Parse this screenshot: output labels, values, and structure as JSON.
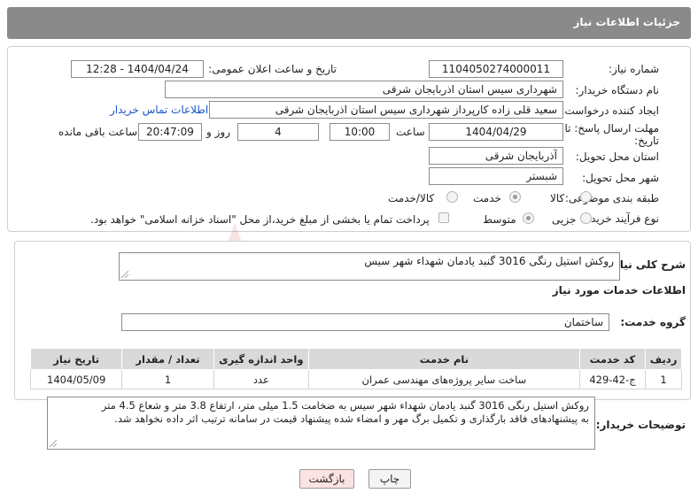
{
  "header": {
    "title": "جزئیات اطلاعات نیاز"
  },
  "form": {
    "need_number_label": "شماره نیاز:",
    "need_number": "1104050274000011",
    "announce_label": "تاریخ و ساعت اعلان عمومی:",
    "announce_value": "1404/04/24 - 12:28",
    "buyer_org_label": "نام دستگاه خریدار:",
    "buyer_org": "شهرداری سیس استان اذربایجان شرقی",
    "creator_label": "ایجاد کننده درخواست:",
    "creator": "سعید قلی زاده کارپرداز شهرداری سیس استان اذربایجان شرقی",
    "contact_link": "اطلاعات تماس خریدار",
    "deadline_label_1": "مهلت ارسال پاسخ: تا",
    "deadline_label_2": "تاریخ:",
    "deadline_date": "1404/04/29",
    "time_label": "ساعت",
    "deadline_time": "10:00",
    "days_value": "4",
    "days_label": "روز و",
    "remaining_time": "20:47:09",
    "remaining_label": "ساعت باقی مانده",
    "province_label": "استان محل تحویل:",
    "province": "آذربایجان شرقی",
    "city_label": "شهر محل تحویل:",
    "city": "شبستر",
    "category_label": "طبقه بندی موضوعی:",
    "category_options": [
      "کالا",
      "خدمت",
      "کالا/خدمت"
    ],
    "category_selected": "خدمت",
    "process_label": "نوع فرآیند خرید :",
    "process_options": [
      "جزیی",
      "متوسط"
    ],
    "process_selected": "متوسط",
    "payment_text": "پرداخت تمام یا بخشی از مبلغ خرید،از محل \"اسناد خزانه اسلامی\" خواهد بود."
  },
  "summary": {
    "label": "شرح کلی نیاز:",
    "text": "روکش استیل رنگی 3016 گنبد یادمان شهداء شهر سیس"
  },
  "services": {
    "section_title": "اطلاعات خدمات مورد نیاز",
    "group_label": "گروه خدمت:",
    "group_value": "ساختمان",
    "columns": [
      "ردیف",
      "کد خدمت",
      "نام خدمت",
      "واحد اندازه گیری",
      "تعداد / مقدار",
      "تاریخ نیاز"
    ],
    "rows": [
      [
        "1",
        "ج-42-429",
        "ساخت سایر پروژه‌های مهندسی عمران",
        "عدد",
        "1",
        "1404/05/09"
      ]
    ]
  },
  "buyer_notes": {
    "label": "توضیحات خریدار:",
    "line1": "روکش استیل رنگی 3016 گنبد یادمان شهداء شهر سیس به ضخامت 1.5 میلی متر، ارتفاع 3.8 متر و شعاع 4.5 متر",
    "line2": "به پیشنهادهای فاقد بارگذاری و تکمیل برگ  مهر و امضاء شده پیشنهاد  قیمت در سامانه ترتیب اثر داده نخواهد شد."
  },
  "buttons": {
    "print": "چاپ",
    "back": "بازگشت"
  },
  "watermark": {
    "brand": "AriaTender.neT"
  },
  "colors": {
    "header": "#8a8a8a",
    "back_button": "#fbe3e3",
    "link": "#1a55c8",
    "watermark": "#c0392b"
  }
}
